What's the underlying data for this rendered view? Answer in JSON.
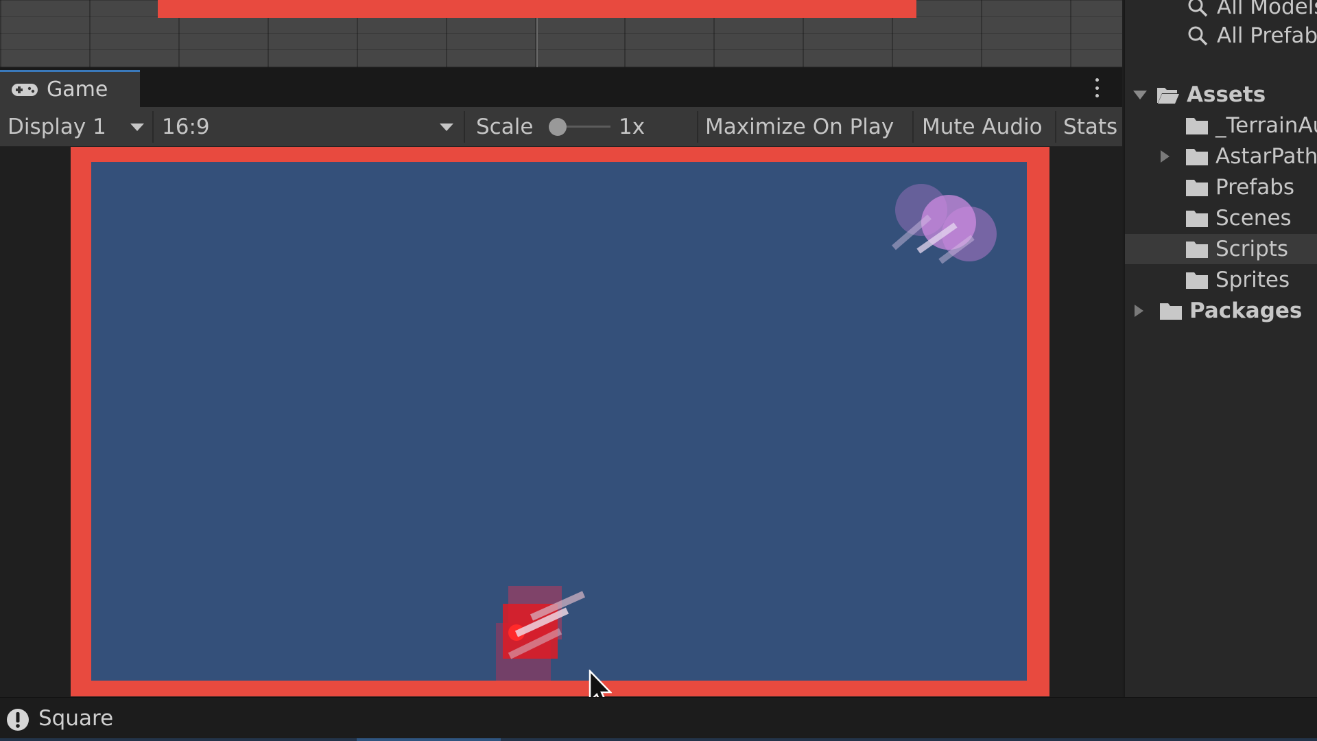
{
  "game_tab": {
    "label": "Game",
    "icon": "gamepad-icon"
  },
  "toolbar": {
    "display_select": "Display 1",
    "aspect_select": "16:9",
    "scale_label": "Scale",
    "scale_value": "1x",
    "maximize_on_play": "Maximize On Play",
    "mute_audio": "Mute Audio",
    "stats": "Stats"
  },
  "project": {
    "search_items": [
      {
        "label": "All Models",
        "icon": "search-icon"
      },
      {
        "label": "All Prefabs",
        "icon": "search-icon"
      }
    ],
    "assets_label": "Assets",
    "asset_folders": [
      {
        "label": "_TerrainAutoUpgrade",
        "expandable": false
      },
      {
        "label": "AstarPathfindingProject",
        "expandable": true
      },
      {
        "label": "Prefabs",
        "expandable": false
      },
      {
        "label": "Scenes",
        "expandable": false
      },
      {
        "label": "Scripts",
        "expandable": false,
        "selected": true
      },
      {
        "label": "Sprites",
        "expandable": false
      }
    ],
    "packages_label": "Packages"
  },
  "status": {
    "text": "Square",
    "icon": "warning-icon"
  },
  "colors": {
    "game_border": "#e84a3f",
    "game_background": "#34507a",
    "player_tank": "#e01b24",
    "enemy_tank": "#c77fd6",
    "tab_accent": "#3a79bb"
  }
}
